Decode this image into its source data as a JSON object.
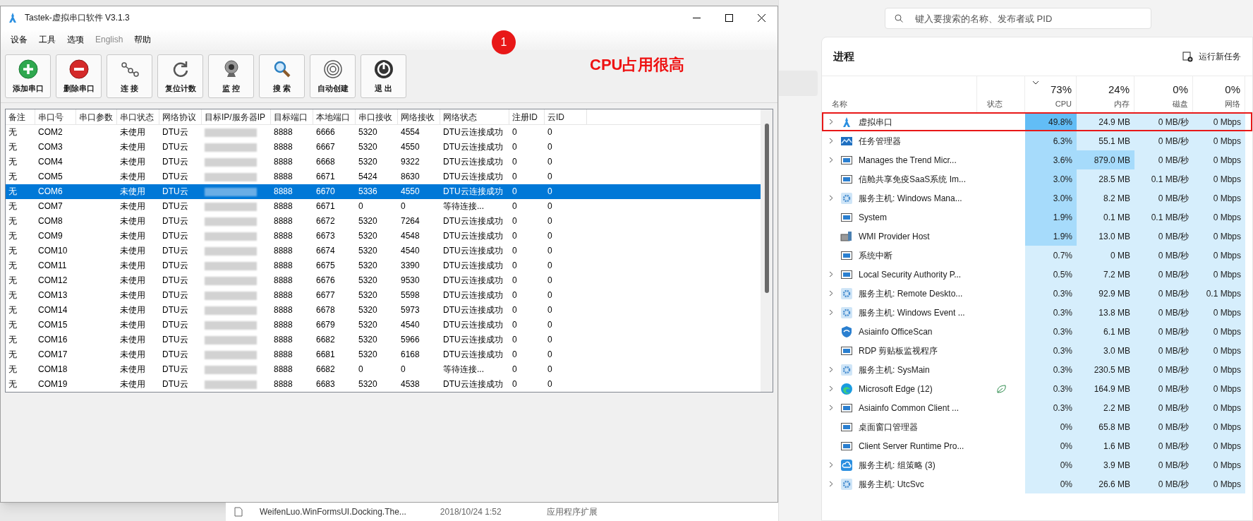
{
  "app_window": {
    "title": "Tastek-虚拟串口软件 V3.1.3",
    "menu": [
      {
        "label": "设备",
        "disabled": false
      },
      {
        "label": "工具",
        "disabled": false
      },
      {
        "label": "选项",
        "disabled": false
      },
      {
        "label": "English",
        "disabled": true
      },
      {
        "label": "帮助",
        "disabled": false
      }
    ],
    "toolbar": [
      {
        "kind": "add",
        "label": "添加串口"
      },
      {
        "kind": "remove",
        "label": "删除串口"
      },
      {
        "kind": "connect",
        "label": "连 接"
      },
      {
        "kind": "reset",
        "label": "复位计数"
      },
      {
        "kind": "monitor",
        "label": "监 控"
      },
      {
        "kind": "search",
        "label": "搜 索"
      },
      {
        "kind": "auto",
        "label": "自动创建"
      },
      {
        "kind": "exit",
        "label": "退 出"
      }
    ],
    "table": {
      "columns": [
        "备注",
        "串口号",
        "串口参数",
        "串口状态",
        "网络协议",
        "目标IP/服务器IP",
        "目标端口",
        "本地端口",
        "串口接收",
        "网络接收",
        "网络状态",
        "注册ID",
        "云ID"
      ],
      "rows": [
        {
          "selected": false,
          "note": "无",
          "port": "COM2",
          "state": "未使用",
          "protocol": "DTU云",
          "target_port": "8888",
          "local_port": "6666",
          "serial_rx": "5320",
          "net_rx": "4554",
          "net_status": "DTU云连接成功",
          "reg_id": "0",
          "cloud_id": "0"
        },
        {
          "selected": false,
          "note": "无",
          "port": "COM3",
          "state": "未使用",
          "protocol": "DTU云",
          "target_port": "8888",
          "local_port": "6667",
          "serial_rx": "5320",
          "net_rx": "4550",
          "net_status": "DTU云连接成功",
          "reg_id": "0",
          "cloud_id": "0"
        },
        {
          "selected": false,
          "note": "无",
          "port": "COM4",
          "state": "未使用",
          "protocol": "DTU云",
          "target_port": "8888",
          "local_port": "6668",
          "serial_rx": "5320",
          "net_rx": "9322",
          "net_status": "DTU云连接成功",
          "reg_id": "0",
          "cloud_id": "0"
        },
        {
          "selected": false,
          "note": "无",
          "port": "COM5",
          "state": "未使用",
          "protocol": "DTU云",
          "target_port": "8888",
          "local_port": "6671",
          "serial_rx": "5424",
          "net_rx": "8630",
          "net_status": "DTU云连接成功",
          "reg_id": "0",
          "cloud_id": "0"
        },
        {
          "selected": true,
          "note": "无",
          "port": "COM6",
          "state": "未使用",
          "protocol": "DTU云",
          "target_port": "8888",
          "local_port": "6670",
          "serial_rx": "5336",
          "net_rx": "4550",
          "net_status": "DTU云连接成功",
          "reg_id": "0",
          "cloud_id": "0"
        },
        {
          "selected": false,
          "note": "无",
          "port": "COM7",
          "state": "未使用",
          "protocol": "DTU云",
          "target_port": "8888",
          "local_port": "6671",
          "serial_rx": "0",
          "net_rx": "0",
          "net_status": "等待连接...",
          "reg_id": "0",
          "cloud_id": "0"
        },
        {
          "selected": false,
          "note": "无",
          "port": "COM8",
          "state": "未使用",
          "protocol": "DTU云",
          "target_port": "8888",
          "local_port": "6672",
          "serial_rx": "5320",
          "net_rx": "7264",
          "net_status": "DTU云连接成功",
          "reg_id": "0",
          "cloud_id": "0"
        },
        {
          "selected": false,
          "note": "无",
          "port": "COM9",
          "state": "未使用",
          "protocol": "DTU云",
          "target_port": "8888",
          "local_port": "6673",
          "serial_rx": "5320",
          "net_rx": "4548",
          "net_status": "DTU云连接成功",
          "reg_id": "0",
          "cloud_id": "0"
        },
        {
          "selected": false,
          "note": "无",
          "port": "COM10",
          "state": "未使用",
          "protocol": "DTU云",
          "target_port": "8888",
          "local_port": "6674",
          "serial_rx": "5320",
          "net_rx": "4540",
          "net_status": "DTU云连接成功",
          "reg_id": "0",
          "cloud_id": "0"
        },
        {
          "selected": false,
          "note": "无",
          "port": "COM11",
          "state": "未使用",
          "protocol": "DTU云",
          "target_port": "8888",
          "local_port": "6675",
          "serial_rx": "5320",
          "net_rx": "3390",
          "net_status": "DTU云连接成功",
          "reg_id": "0",
          "cloud_id": "0"
        },
        {
          "selected": false,
          "note": "无",
          "port": "COM12",
          "state": "未使用",
          "protocol": "DTU云",
          "target_port": "8888",
          "local_port": "6676",
          "serial_rx": "5320",
          "net_rx": "9530",
          "net_status": "DTU云连接成功",
          "reg_id": "0",
          "cloud_id": "0"
        },
        {
          "selected": false,
          "note": "无",
          "port": "COM13",
          "state": "未使用",
          "protocol": "DTU云",
          "target_port": "8888",
          "local_port": "6677",
          "serial_rx": "5320",
          "net_rx": "5598",
          "net_status": "DTU云连接成功",
          "reg_id": "0",
          "cloud_id": "0"
        },
        {
          "selected": false,
          "note": "无",
          "port": "COM14",
          "state": "未使用",
          "protocol": "DTU云",
          "target_port": "8888",
          "local_port": "6678",
          "serial_rx": "5320",
          "net_rx": "5973",
          "net_status": "DTU云连接成功",
          "reg_id": "0",
          "cloud_id": "0"
        },
        {
          "selected": false,
          "note": "无",
          "port": "COM15",
          "state": "未使用",
          "protocol": "DTU云",
          "target_port": "8888",
          "local_port": "6679",
          "serial_rx": "5320",
          "net_rx": "4540",
          "net_status": "DTU云连接成功",
          "reg_id": "0",
          "cloud_id": "0"
        },
        {
          "selected": false,
          "note": "无",
          "port": "COM16",
          "state": "未使用",
          "protocol": "DTU云",
          "target_port": "8888",
          "local_port": "6682",
          "serial_rx": "5320",
          "net_rx": "5966",
          "net_status": "DTU云连接成功",
          "reg_id": "0",
          "cloud_id": "0"
        },
        {
          "selected": false,
          "note": "无",
          "port": "COM17",
          "state": "未使用",
          "protocol": "DTU云",
          "target_port": "8888",
          "local_port": "6681",
          "serial_rx": "5320",
          "net_rx": "6168",
          "net_status": "DTU云连接成功",
          "reg_id": "0",
          "cloud_id": "0"
        },
        {
          "selected": false,
          "note": "无",
          "port": "COM18",
          "state": "未使用",
          "protocol": "DTU云",
          "target_port": "8888",
          "local_port": "6682",
          "serial_rx": "0",
          "net_rx": "0",
          "net_status": "等待连接...",
          "reg_id": "0",
          "cloud_id": "0"
        },
        {
          "selected": false,
          "note": "无",
          "port": "COM19",
          "state": "未使用",
          "protocol": "DTU云",
          "target_port": "8888",
          "local_port": "6683",
          "serial_rx": "5320",
          "net_rx": "4538",
          "net_status": "DTU云连接成功",
          "reg_id": "0",
          "cloud_id": "0"
        }
      ]
    }
  },
  "annotation": {
    "marker": "1",
    "note": "CPU占用很高"
  },
  "background_file": {
    "name": "WeifenLuo.WinFormsUI.Docking.The...",
    "date": "2018/10/24 1:52",
    "type": "应用程序扩展"
  },
  "task_manager": {
    "search": {
      "placeholder": "键入要搜索的名称、发布者或 PID"
    },
    "title": "进程",
    "run_task": "运行新任务",
    "columns": [
      {
        "label": "名称"
      },
      {
        "label": "状态"
      },
      {
        "label": "CPU",
        "total": "73%",
        "sorted": true
      },
      {
        "label": "内存",
        "total": "24%",
        "sorted": false
      },
      {
        "label": "磁盘",
        "total": "0%",
        "sorted": false
      },
      {
        "label": "网络",
        "total": "0%",
        "sorted": false
      }
    ],
    "rows": [
      {
        "name": "虚拟串口",
        "kind": "app",
        "expandable": true,
        "highlighted": true,
        "eco": false,
        "cpu": {
          "text": "49.8%",
          "color": "#62bdf6"
        },
        "memory": {
          "text": "24.9 MB",
          "color": "#d6eefc"
        },
        "disk": "0 MB/秒",
        "network": "0 Mbps"
      },
      {
        "name": "任务管理器",
        "kind": "chart",
        "expandable": true,
        "highlighted": false,
        "eco": false,
        "cpu": {
          "text": "6.3%",
          "color": "#a6dbfb"
        },
        "memory": {
          "text": "55.1 MB",
          "color": "#d6eefc"
        },
        "disk": "0 MB/秒",
        "network": "0 Mbps"
      },
      {
        "name": "Manages the Trend Micr...",
        "kind": "window",
        "expandable": true,
        "highlighted": false,
        "eco": false,
        "cpu": {
          "text": "3.6%",
          "color": "#a6dbfb"
        },
        "memory": {
          "text": "879.0 MB",
          "color": "#a6dbfb"
        },
        "disk": "0 MB/秒",
        "network": "0 Mbps"
      },
      {
        "name": "信舱共享免疫SaaS系统 Im...",
        "kind": "window",
        "expandable": false,
        "highlighted": false,
        "eco": false,
        "cpu": {
          "text": "3.0%",
          "color": "#a6dbfb"
        },
        "memory": {
          "text": "28.5 MB",
          "color": "#d6eefc"
        },
        "disk": "0.1 MB/秒",
        "network": "0 Mbps"
      },
      {
        "name": "服务主机: Windows Mana...",
        "kind": "gear",
        "expandable": true,
        "highlighted": false,
        "eco": false,
        "cpu": {
          "text": "3.0%",
          "color": "#a6dbfb"
        },
        "memory": {
          "text": "8.2 MB",
          "color": "#d6eefc"
        },
        "disk": "0 MB/秒",
        "network": "0 Mbps"
      },
      {
        "name": "System",
        "kind": "window",
        "expandable": false,
        "highlighted": false,
        "eco": false,
        "cpu": {
          "text": "1.9%",
          "color": "#a6dbfb"
        },
        "memory": {
          "text": "0.1 MB",
          "color": "#d6eefc"
        },
        "disk": "0.1 MB/秒",
        "network": "0 Mbps"
      },
      {
        "name": "WMI Provider Host",
        "kind": "wmi",
        "expandable": false,
        "highlighted": false,
        "eco": false,
        "cpu": {
          "text": "1.9%",
          "color": "#a6dbfb"
        },
        "memory": {
          "text": "13.0 MB",
          "color": "#d6eefc"
        },
        "disk": "0 MB/秒",
        "network": "0 Mbps"
      },
      {
        "name": "系统中断",
        "kind": "window",
        "expandable": false,
        "highlighted": false,
        "eco": false,
        "cpu": {
          "text": "0.7%",
          "color": "#d6eefc"
        },
        "memory": {
          "text": "0 MB",
          "color": "#d6eefc"
        },
        "disk": "0 MB/秒",
        "network": "0 Mbps"
      },
      {
        "name": "Local Security Authority P...",
        "kind": "window",
        "expandable": true,
        "highlighted": false,
        "eco": false,
        "cpu": {
          "text": "0.5%",
          "color": "#d6eefc"
        },
        "memory": {
          "text": "7.2 MB",
          "color": "#d6eefc"
        },
        "disk": "0 MB/秒",
        "network": "0 Mbps"
      },
      {
        "name": "服务主机: Remote Deskto...",
        "kind": "gear",
        "expandable": true,
        "highlighted": false,
        "eco": false,
        "cpu": {
          "text": "0.3%",
          "color": "#d6eefc"
        },
        "memory": {
          "text": "92.9 MB",
          "color": "#d6eefc"
        },
        "disk": "0 MB/秒",
        "network": "0.1 Mbps"
      },
      {
        "name": "服务主机: Windows Event ...",
        "kind": "gear",
        "expandable": true,
        "highlighted": false,
        "eco": false,
        "cpu": {
          "text": "0.3%",
          "color": "#d6eefc"
        },
        "memory": {
          "text": "13.8 MB",
          "color": "#d6eefc"
        },
        "disk": "0 MB/秒",
        "network": "0 Mbps"
      },
      {
        "name": "Asiainfo OfficeScan",
        "kind": "shield",
        "expandable": false,
        "highlighted": false,
        "eco": false,
        "cpu": {
          "text": "0.3%",
          "color": "#d6eefc"
        },
        "memory": {
          "text": "6.1 MB",
          "color": "#d6eefc"
        },
        "disk": "0 MB/秒",
        "network": "0 Mbps"
      },
      {
        "name": "RDP 剪贴板监视程序",
        "kind": "window",
        "expandable": false,
        "highlighted": false,
        "eco": false,
        "cpu": {
          "text": "0.3%",
          "color": "#d6eefc"
        },
        "memory": {
          "text": "3.0 MB",
          "color": "#d6eefc"
        },
        "disk": "0 MB/秒",
        "network": "0 Mbps"
      },
      {
        "name": "服务主机: SysMain",
        "kind": "gear",
        "expandable": true,
        "highlighted": false,
        "eco": false,
        "cpu": {
          "text": "0.3%",
          "color": "#d6eefc"
        },
        "memory": {
          "text": "230.5 MB",
          "color": "#d6eefc"
        },
        "disk": "0 MB/秒",
        "network": "0 Mbps"
      },
      {
        "name": "Microsoft Edge (12)",
        "kind": "browser",
        "expandable": true,
        "highlighted": false,
        "eco": true,
        "cpu": {
          "text": "0.3%",
          "color": "#d6eefc"
        },
        "memory": {
          "text": "164.9 MB",
          "color": "#d6eefc"
        },
        "disk": "0 MB/秒",
        "network": "0 Mbps"
      },
      {
        "name": "Asiainfo Common Client ...",
        "kind": "window",
        "expandable": true,
        "highlighted": false,
        "eco": false,
        "cpu": {
          "text": "0.3%",
          "color": "#d6eefc"
        },
        "memory": {
          "text": "2.2 MB",
          "color": "#d6eefc"
        },
        "disk": "0 MB/秒",
        "network": "0 Mbps"
      },
      {
        "name": "桌面窗口管理器",
        "kind": "window",
        "expandable": false,
        "highlighted": false,
        "eco": false,
        "cpu": {
          "text": "0%",
          "color": "#d6eefc"
        },
        "memory": {
          "text": "65.8 MB",
          "color": "#d6eefc"
        },
        "disk": "0 MB/秒",
        "network": "0 Mbps"
      },
      {
        "name": "Client Server Runtime Pro...",
        "kind": "window",
        "expandable": false,
        "highlighted": false,
        "eco": false,
        "cpu": {
          "text": "0%",
          "color": "#d6eefc"
        },
        "memory": {
          "text": "1.6 MB",
          "color": "#d6eefc"
        },
        "disk": "0 MB/秒",
        "network": "0 Mbps"
      },
      {
        "name": "服务主机: 组策略 (3)",
        "kind": "cloud",
        "expandable": true,
        "highlighted": false,
        "eco": false,
        "cpu": {
          "text": "0%",
          "color": "#d6eefc"
        },
        "memory": {
          "text": "3.9 MB",
          "color": "#d6eefc"
        },
        "disk": "0 MB/秒",
        "network": "0 Mbps"
      },
      {
        "name": "服务主机: UtcSvc",
        "kind": "gear",
        "expandable": true,
        "highlighted": false,
        "eco": false,
        "cpu": {
          "text": "0%",
          "color": "#d6eefc"
        },
        "memory": {
          "text": "26.6 MB",
          "color": "#d6eefc"
        },
        "disk": "0 MB/秒",
        "network": "0 Mbps"
      }
    ]
  }
}
